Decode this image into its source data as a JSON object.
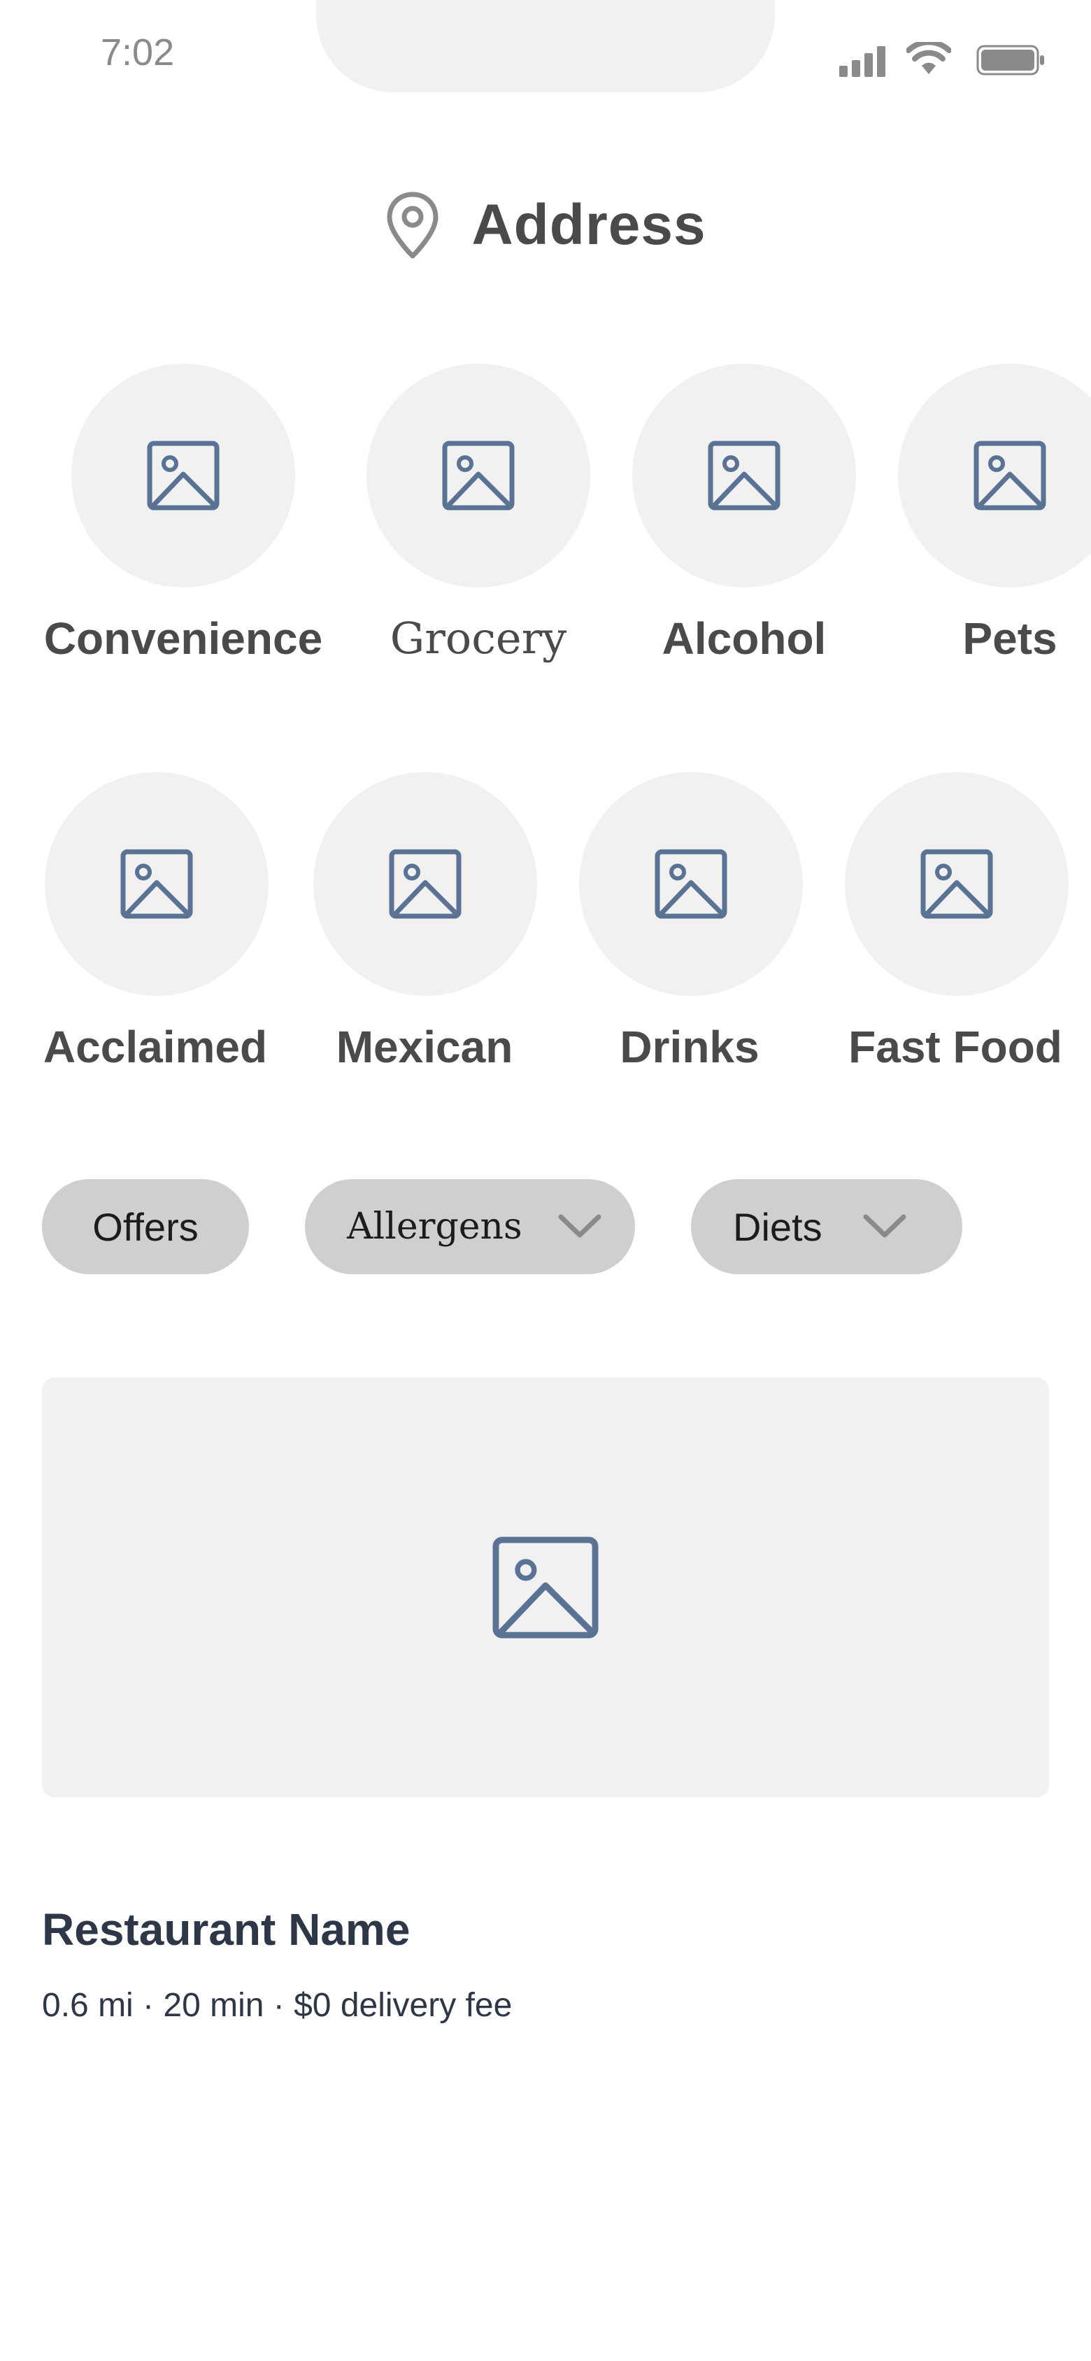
{
  "status_bar": {
    "time": "7:02",
    "icons": [
      "cellular-signal-icon",
      "wifi-icon",
      "battery-icon"
    ]
  },
  "header": {
    "icon": "location-pin-icon",
    "title": "Address"
  },
  "categories": {
    "row1": [
      {
        "label": "Convenience",
        "icon": "image-placeholder-icon"
      },
      {
        "label": "Grocery",
        "icon": "image-placeholder-icon"
      },
      {
        "label": "Alcohol",
        "icon": "image-placeholder-icon"
      },
      {
        "label": "Pets",
        "icon": "image-placeholder-icon"
      }
    ],
    "row2": [
      {
        "label": "Acclaimed",
        "icon": "image-placeholder-icon"
      },
      {
        "label": "Mexican",
        "icon": "image-placeholder-icon"
      },
      {
        "label": "Drinks",
        "icon": "image-placeholder-icon"
      },
      {
        "label": "Fast Food",
        "icon": "image-placeholder-icon"
      }
    ]
  },
  "filters": [
    {
      "label": "Offers",
      "has_dropdown": false
    },
    {
      "label": "Allergens",
      "has_dropdown": true
    },
    {
      "label": "Diets",
      "has_dropdown": true
    }
  ],
  "restaurant": {
    "image_icon": "image-placeholder-icon",
    "name": "Restaurant Name",
    "meta": "0.6 mi · 20 min · $0 delivery fee"
  },
  "colors": {
    "placeholder_bg": "#f1f1f1",
    "icon_blue": "#5a7394",
    "chip_bg": "#cfcfcf",
    "text_dark": "#4a4a4a",
    "text_navy": "#2d3748"
  }
}
